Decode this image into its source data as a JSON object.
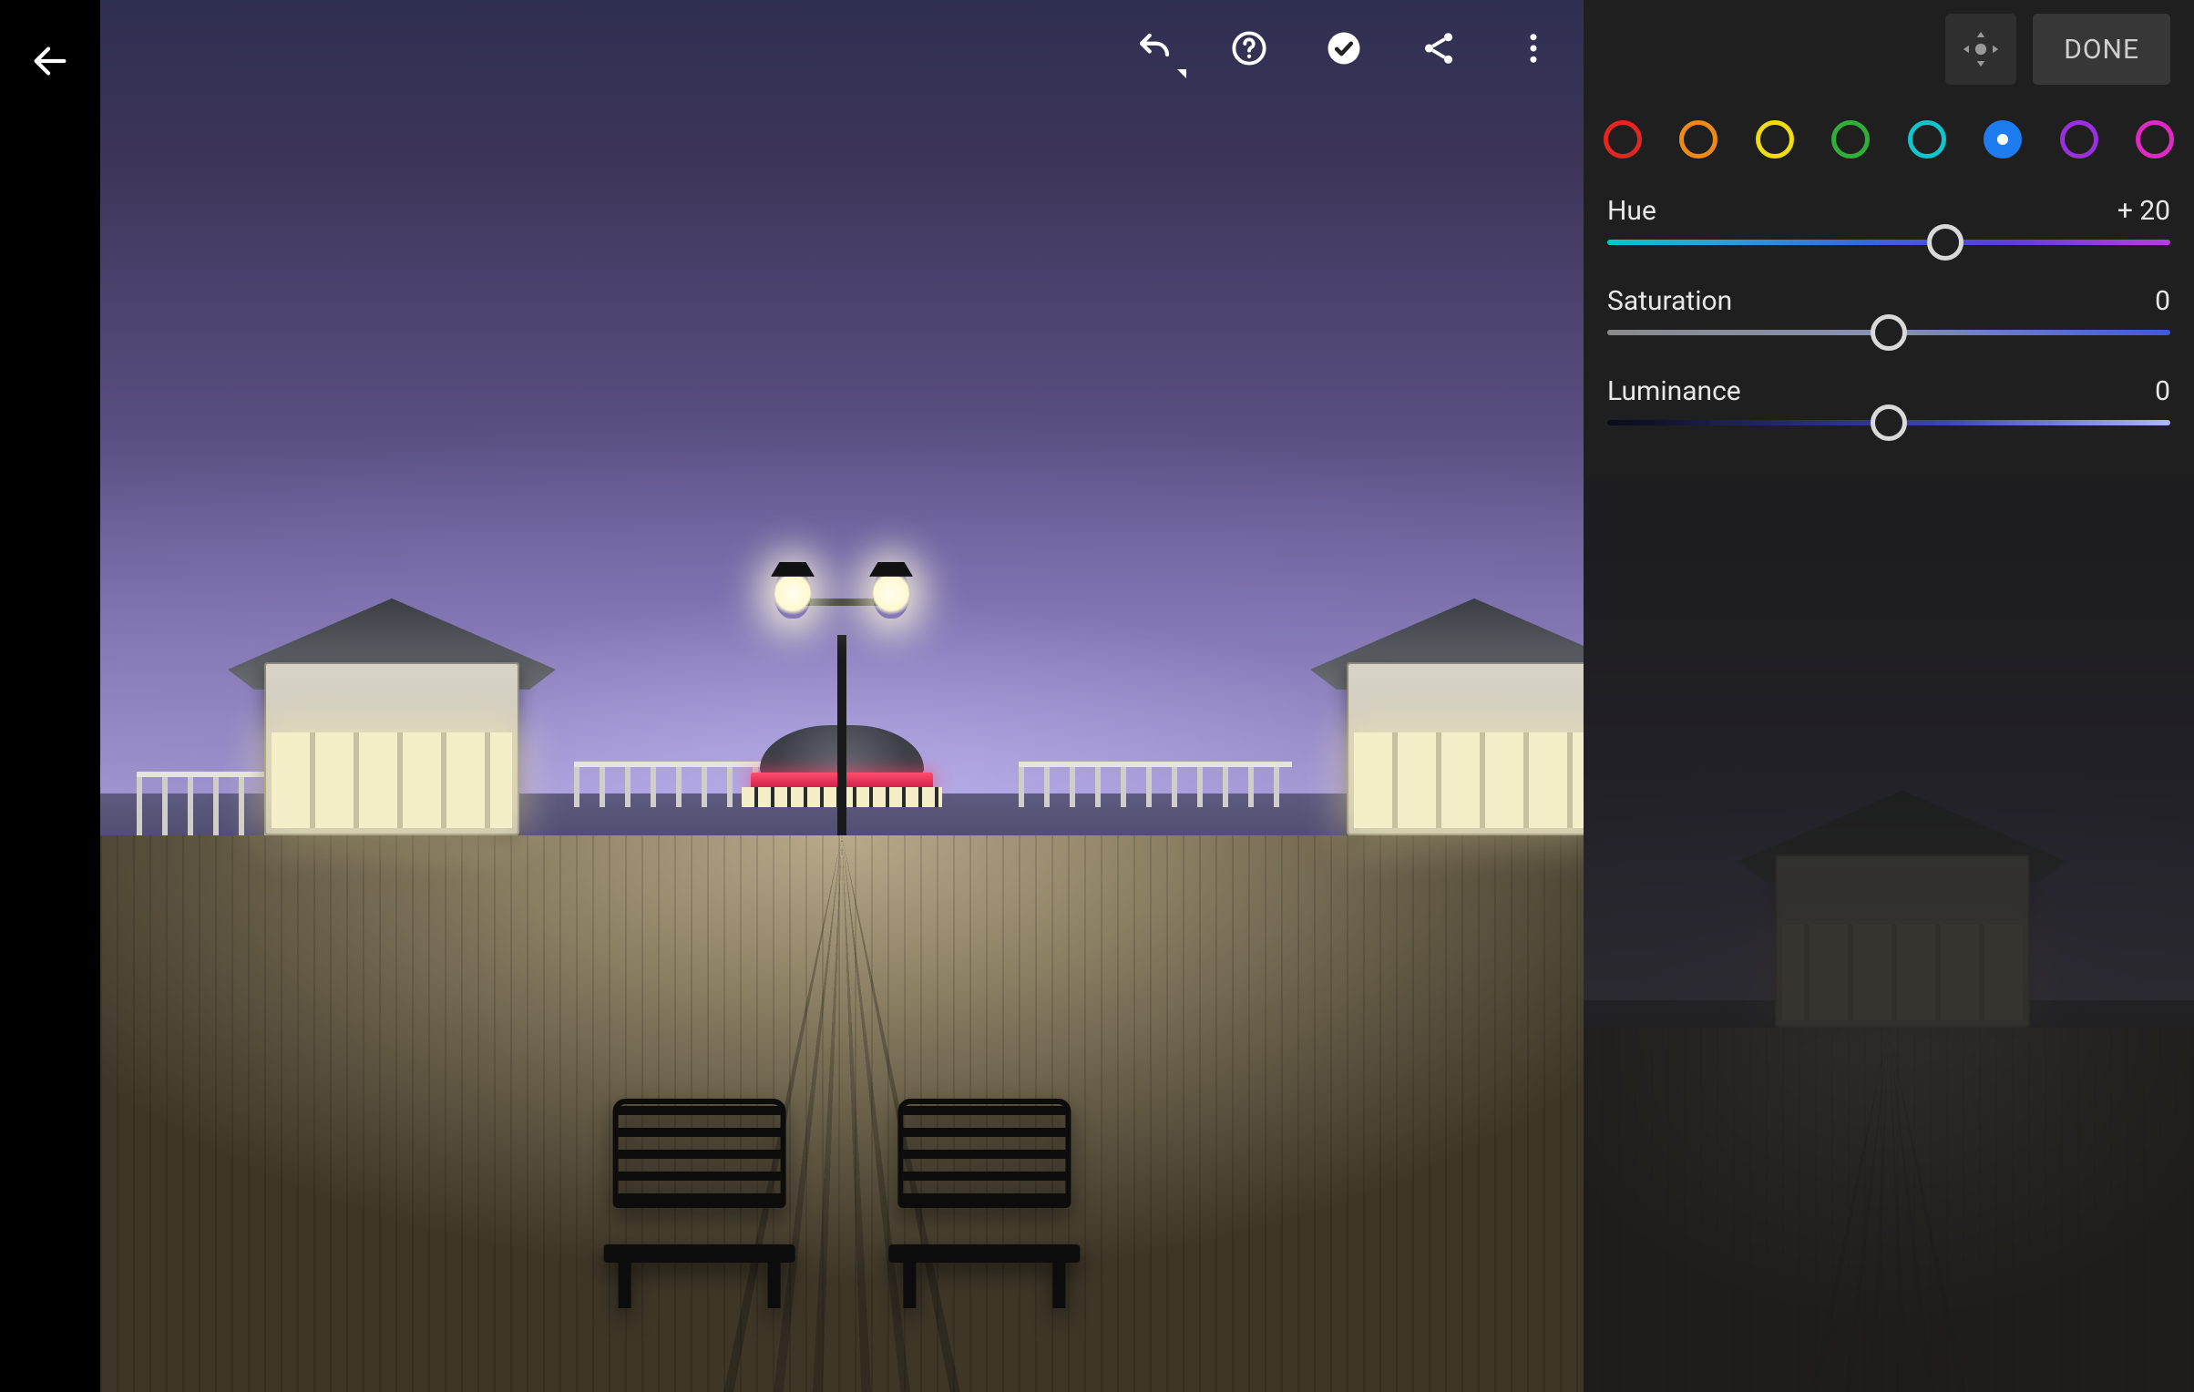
{
  "actions": {
    "back_label": "Back",
    "undo_label": "Undo",
    "help_label": "Help",
    "confirm_label": "Confirm",
    "share_label": "Share",
    "more_label": "More options",
    "move_label": "Move Panel",
    "done_label": "DONE"
  },
  "color_mix": {
    "swatches": [
      {
        "name": "red",
        "color": "#e52620",
        "selected": false
      },
      {
        "name": "orange",
        "color": "#ee8a17",
        "selected": false
      },
      {
        "name": "yellow",
        "color": "#f2dc0f",
        "selected": false
      },
      {
        "name": "green",
        "color": "#2fae3a",
        "selected": false
      },
      {
        "name": "aqua",
        "color": "#12c4cc",
        "selected": false
      },
      {
        "name": "blue",
        "color": "#1c7cf0",
        "selected": true
      },
      {
        "name": "purple",
        "color": "#9a2fe0",
        "selected": false
      },
      {
        "name": "magenta",
        "color": "#e028c4",
        "selected": false
      }
    ],
    "sliders": {
      "hue": {
        "label": "Hue",
        "value": 20,
        "display": "+ 20",
        "min": -100,
        "max": 100
      },
      "saturation": {
        "label": "Saturation",
        "value": 0,
        "display": "0",
        "min": -100,
        "max": 100
      },
      "luminance": {
        "label": "Luminance",
        "value": 0,
        "display": "0",
        "min": -100,
        "max": 100
      }
    }
  }
}
